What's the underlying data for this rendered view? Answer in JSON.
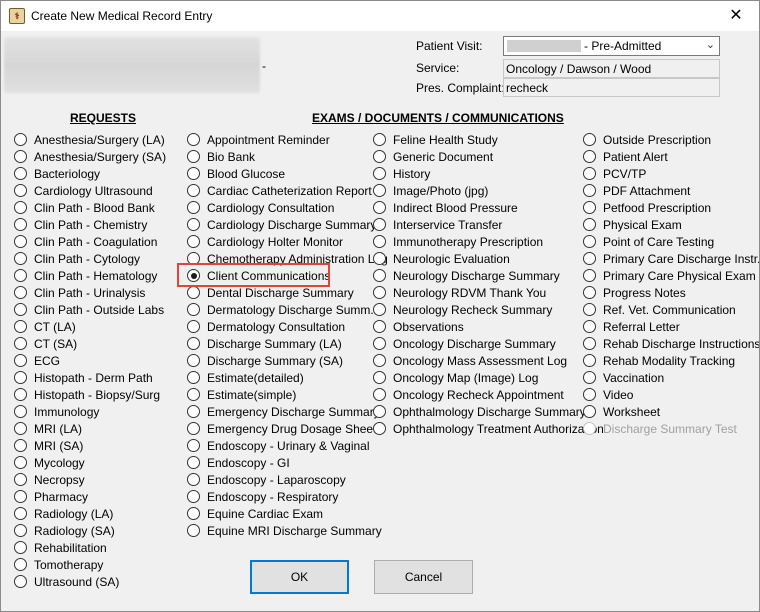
{
  "window": {
    "title": "Create New Medical Record Entry",
    "close_glyph": "✕",
    "icon": "app-icon"
  },
  "header": {
    "dash": "-",
    "patient_visit_label": "Patient Visit:",
    "patient_visit_value": "- Pre-Admitted",
    "service_label": "Service:",
    "service_value": "Oncology / Dawson / Wood",
    "complaint_label": "Pres. Complaint:",
    "complaint_value": "recheck"
  },
  "sections": {
    "requests_title": "REQUESTS",
    "exams_title": "EXAMS / DOCUMENTS / COMMUNICATIONS"
  },
  "requests": [
    "Anesthesia/Surgery (LA)",
    "Anesthesia/Surgery (SA)",
    "Bacteriology",
    "Cardiology Ultrasound",
    "Clin Path - Blood Bank",
    "Clin Path - Chemistry",
    "Clin Path - Coagulation",
    "Clin Path - Cytology",
    "Clin Path - Hematology",
    "Clin Path - Urinalysis",
    "Clin Path - Outside Labs",
    "CT (LA)",
    "CT (SA)",
    "ECG",
    "Histopath - Derm Path",
    "Histopath - Biopsy/Surg",
    "Immunology",
    "MRI (LA)",
    "MRI (SA)",
    "Mycology",
    "Necropsy",
    "Pharmacy",
    "Radiology  (LA)",
    "Radiology  (SA)",
    "Rehabilitation",
    "Tomotherapy",
    "Ultrasound (SA)"
  ],
  "exams_col1": [
    "Appointment Reminder",
    "Bio Bank",
    "Blood Glucose",
    "Cardiac Catheterization Report",
    "Cardiology Consultation",
    "Cardiology Discharge Summary",
    "Cardiology Holter Monitor",
    "Chemotherapy Administration Log",
    "Client Communications",
    "Dental Discharge Summary",
    "Dermatology Discharge Summ.",
    "Dermatology Consultation",
    "Discharge Summary (LA)",
    "Discharge Summary (SA)",
    "Estimate(detailed)",
    "Estimate(simple)",
    "Emergency Discharge Summary",
    "Emergency Drug Dosage Sheet",
    "Endoscopy - Urinary & Vaginal",
    "Endoscopy - GI",
    "Endoscopy - Laparoscopy",
    "Endoscopy - Respiratory",
    "Equine Cardiac Exam",
    "Equine MRI Discharge Summary"
  ],
  "exams_col2": [
    "Feline Health Study",
    "Generic Document",
    "History",
    "Image/Photo (jpg)",
    "Indirect Blood Pressure",
    "Interservice Transfer",
    "Immunotherapy Prescription",
    "Neurologic Evaluation",
    "Neurology Discharge Summary",
    "Neurology RDVM Thank You",
    "Neurology Recheck Summary",
    "Observations",
    "Oncology Discharge Summary",
    "Oncology Mass Assessment Log",
    "Oncology Map (Image) Log",
    "Oncology Recheck Appointment",
    "Ophthalmology Discharge Summary",
    "Ophthalmology Treatment Authorization"
  ],
  "exams_col3": [
    "Outside Prescription",
    "Patient Alert",
    "PCV/TP",
    "PDF Attachment",
    "Petfood Prescription",
    "Physical Exam",
    "Point of Care Testing",
    "Primary Care Discharge Instr.",
    "Primary Care Physical Exam",
    "Progress Notes",
    "Ref. Vet. Communication",
    "Referral Letter",
    "Rehab Discharge Instructions",
    "Rehab Modality Tracking",
    "Vaccination",
    "Video",
    "Worksheet",
    "Discharge Summary Test"
  ],
  "selected": "Client Communications",
  "disabled": [
    "Discharge Summary Test"
  ],
  "buttons": {
    "ok": "OK",
    "cancel": "Cancel"
  },
  "colors": {
    "highlight": "#e0453a",
    "default_button_border": "#0078d7"
  }
}
